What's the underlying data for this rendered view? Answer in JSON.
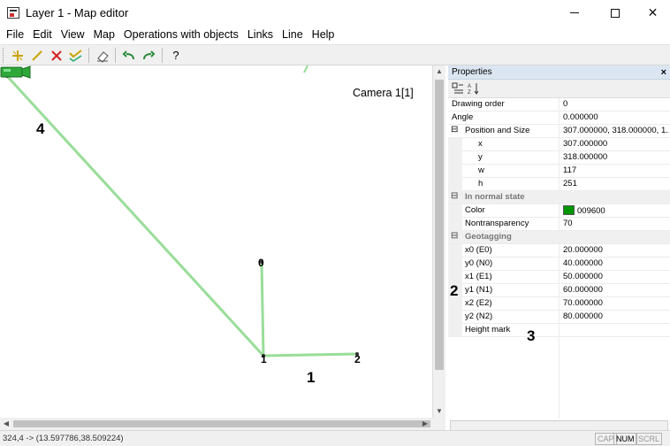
{
  "window": {
    "title": "Layer 1 - Map editor"
  },
  "menu": [
    "File",
    "Edit",
    "View",
    "Map",
    "Operations with objects",
    "Links",
    "Line",
    "Help"
  ],
  "toolbar": {
    "icons": [
      "add-point-icon",
      "draw-line-icon",
      "delete-icon",
      "check-icon",
      "eraser-icon",
      "undo-icon",
      "redo-icon",
      "help-icon"
    ],
    "help_label": "?"
  },
  "map": {
    "camera_label": "Camera 1[1]",
    "annotations": [
      "4",
      "1",
      "2",
      "3"
    ],
    "node_labels": [
      "0",
      "1",
      "2"
    ],
    "line_color": "#99dd99"
  },
  "properties": {
    "title": "Properties",
    "close_label": "×",
    "rows": [
      {
        "name": "Drawing order",
        "value": "0"
      },
      {
        "name": "Angle",
        "value": "0.000000"
      },
      {
        "name": "Position and Size",
        "value": "307.000000, 318.000000, 1...",
        "expander": "⊟"
      },
      {
        "name": "x",
        "value": "307.000000"
      },
      {
        "name": "y",
        "value": "318.000000"
      },
      {
        "name": "w",
        "value": "117"
      },
      {
        "name": "h",
        "value": "251"
      },
      {
        "name": "In normal state",
        "value": "",
        "expander": "⊟"
      },
      {
        "name": "Color",
        "value": "009600",
        "swatch": "#009600"
      },
      {
        "name": "Nontransparency",
        "value": "70"
      },
      {
        "name": "Geotagging",
        "value": "",
        "expander": "⊟"
      },
      {
        "name": "x0 (E0)",
        "value": "20.000000"
      },
      {
        "name": "y0 (N0)",
        "value": "40.000000"
      },
      {
        "name": "x1 (E1)",
        "value": "50.000000"
      },
      {
        "name": "y1 (N1)",
        "value": "60.000000"
      },
      {
        "name": "x2 (E2)",
        "value": "70.000000"
      },
      {
        "name": "y2 (N2)",
        "value": "80.000000"
      },
      {
        "name": "Height mark",
        "value": ""
      }
    ]
  },
  "status": {
    "coords": "324,4 -> (13.597786,38.509224)",
    "indicators": [
      "CAP",
      "NUM",
      "SCRL"
    ]
  }
}
